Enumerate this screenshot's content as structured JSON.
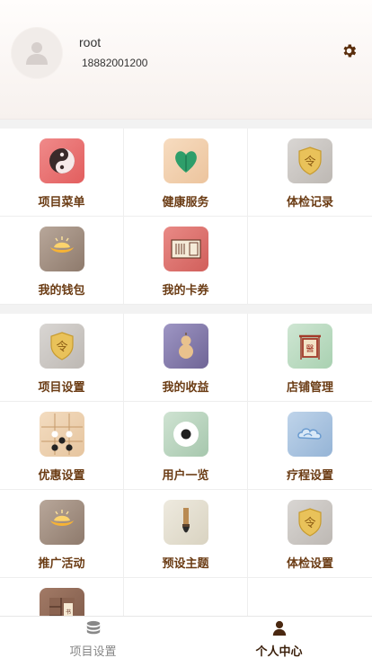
{
  "profile": {
    "username": "root",
    "phone": "18882001200"
  },
  "section1": [
    {
      "label": "项目菜单",
      "icon": "yin-yang-icon"
    },
    {
      "label": "健康服务",
      "icon": "heart-leaf-icon"
    },
    {
      "label": "体检记录",
      "icon": "shield-order-icon"
    },
    {
      "label": "我的钱包",
      "icon": "ingot-icon"
    },
    {
      "label": "我的卡券",
      "icon": "scroll-card-icon"
    }
  ],
  "section2": [
    {
      "label": "项目设置",
      "icon": "shield-order-icon"
    },
    {
      "label": "我的收益",
      "icon": "gourd-icon"
    },
    {
      "label": "店铺管理",
      "icon": "shop-sign-icon"
    },
    {
      "label": "优惠设置",
      "icon": "go-board-icon"
    },
    {
      "label": "用户一览",
      "icon": "go-stone-icon"
    },
    {
      "label": "疗程设置",
      "icon": "cloud-icon"
    },
    {
      "label": "推广活动",
      "icon": "ingot-icon"
    },
    {
      "label": "预设主题",
      "icon": "brush-icon"
    },
    {
      "label": "体检设置",
      "icon": "shield-order-icon"
    },
    {
      "label": "",
      "icon": "bookshelf-icon"
    }
  ],
  "tabbar": {
    "tabs": [
      {
        "label": "项目设置",
        "icon": "database-icon",
        "active": false
      },
      {
        "label": "个人中心",
        "icon": "person-icon",
        "active": true
      }
    ]
  },
  "colors": {
    "label": "#6b3c14",
    "active_tab": "#3a1f0a",
    "inactive_tab": "#888888"
  }
}
